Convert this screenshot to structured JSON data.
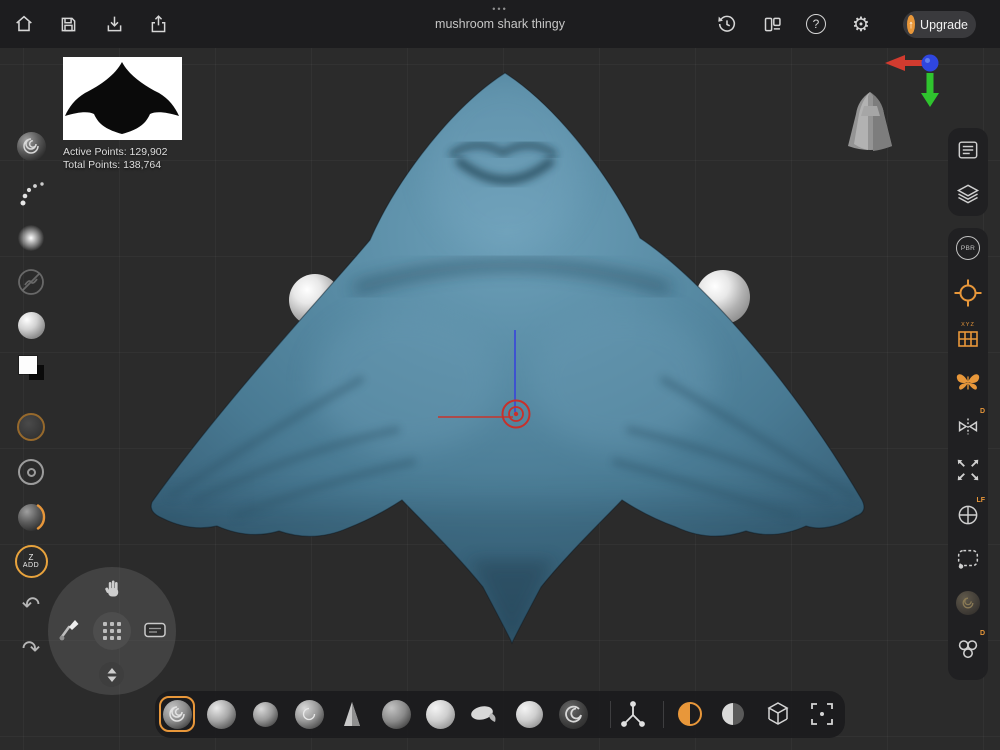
{
  "app": {
    "title": "mushroom shark thingy",
    "overflow_dots": "•••"
  },
  "topbar": {
    "upgrade_label": "Upgrade",
    "help_glyph": "?",
    "gear_glyph": "⚙"
  },
  "stats": {
    "active_points": "Active Points: 129,902",
    "total_points": "Total Points: 138,764"
  },
  "left_toolbar": {
    "zadd_top": "Z",
    "zadd_bottom": "ADD",
    "undo_glyph": "↶",
    "redo_glyph": "↷"
  },
  "right_toolbar": {
    "pbr_label": "PBR",
    "xyz_label": "XYZ",
    "mirror_badge": "D",
    "light_badge": "LF",
    "objects_badge": "D"
  },
  "colors": {
    "accent_orange": "#e8973a",
    "model_blue": "#4e7d97",
    "axis_red": "#d23b2f",
    "axis_green": "#2fc42e",
    "axis_blue": "#2f46e0",
    "target_red": "#c8302a",
    "topbar_bg": "#1d1d1f",
    "canvas_bg": "#2b2b2b"
  }
}
